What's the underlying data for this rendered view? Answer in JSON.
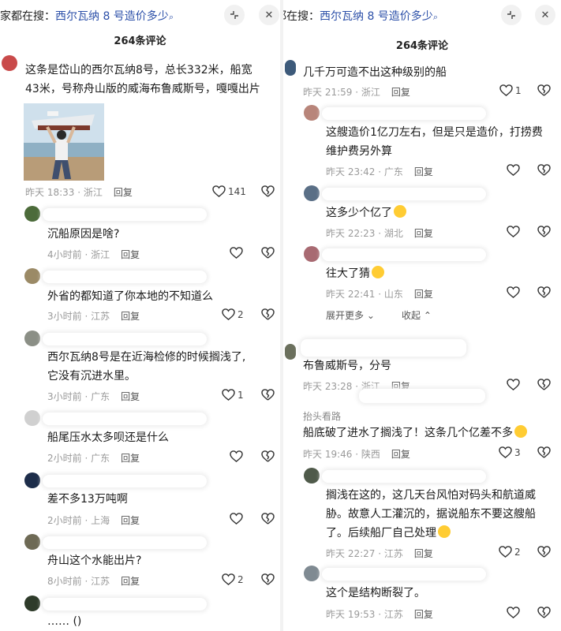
{
  "left": {
    "search_prefix": "家都在搜：",
    "search_keyword": "西尔瓦纳 8 号造价多少",
    "count": "264条评论",
    "post": {
      "text_line1": "这条是岱山的西尔瓦纳8号，总长332米，船宽",
      "text_line2": "43米，号称舟山版的威海布鲁威斯号，嘎嘎出片",
      "time": "昨天 18:33 · 浙江",
      "reply": "回复",
      "likes": "141"
    },
    "comments": [
      {
        "text": "沉船原因是啥?",
        "time": "4小时前 · 浙江",
        "reply": "回复",
        "likes": ""
      },
      {
        "text": "外省的都知道了你本地的不知道么",
        "time": "3小时前 · 江苏",
        "reply": "回复",
        "likes": "2"
      },
      {
        "text1": "西尔瓦纳8号是在近海检修的时候搁浅了,",
        "text2": "它没有沉进水里。",
        "time": "3小时前 · 广东",
        "reply": "回复",
        "likes": "1"
      },
      {
        "text": "船尾压水太多呗还是什么",
        "time": "2小时前 · 广东",
        "reply": "回复",
        "likes": ""
      },
      {
        "text": "差不多13万吨啊",
        "time": "2小时前 · 上海",
        "reply": "回复",
        "likes": ""
      },
      {
        "text": "舟山这个水能出片?",
        "time": "8小时前 · 江苏",
        "reply": "回复",
        "likes": "2"
      },
      {
        "text": "…… ()",
        "time": "",
        "reply": "",
        "likes": ""
      }
    ]
  },
  "right": {
    "search_prefix": "家都在搜：",
    "search_keyword": "西尔瓦纳 8 号造价多少",
    "count": "264条评论",
    "comments": [
      {
        "text": "几千万可造不出这种级别的船",
        "time": "昨天 21:59 · 浙江",
        "reply": "回复",
        "likes": "1"
      },
      {
        "text1": "这艘造价1亿刀左右，但是只是造价，打捞费",
        "text2": "维护费另外算",
        "time": "昨天 23:42 · 广东",
        "reply": "回复",
        "likes": ""
      },
      {
        "text": "这多少个亿了",
        "time": "昨天 22:23 · 湖北",
        "reply": "回复",
        "likes": ""
      },
      {
        "text": "往大了猜",
        "time": "昨天 22:41 · 山东",
        "reply": "回复",
        "likes": ""
      },
      {
        "text": "布鲁威斯号，分号",
        "time": "昨天 23:28 · 浙江",
        "reply": "回复",
        "likes": ""
      },
      {
        "username": "抬头看路",
        "text": "船底破了进水了搁浅了！这条几个亿差不多",
        "time": "昨天 19:46 · 陕西",
        "reply": "回复",
        "likes": "3"
      },
      {
        "text1": "搁浅在这的，这几天台风怕对码头和航道威",
        "text2": "胁。故意人工灌沉的，据说船东不要这艘船",
        "text3": "了。后续船厂自己处理",
        "time": "昨天 22:27 · 江苏",
        "reply": "回复",
        "likes": "2"
      },
      {
        "text": "这个是结构断裂了。",
        "time": "昨天 19:53 · 江苏",
        "reply": "回复",
        "likes": ""
      }
    ],
    "expand_more": "展开更多",
    "collapse": "收起"
  }
}
